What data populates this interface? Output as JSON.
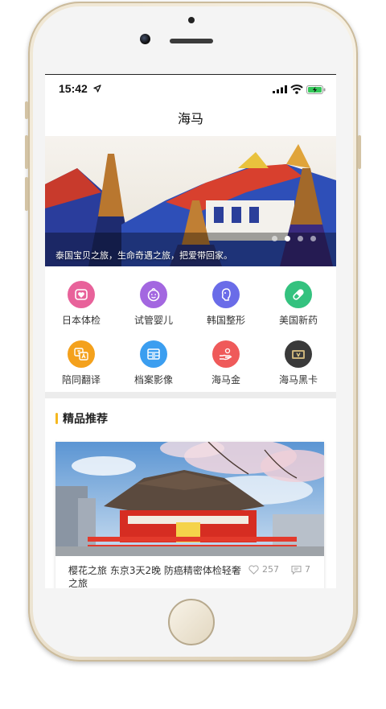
{
  "status_bar": {
    "time": "15:42"
  },
  "nav": {
    "title": "海马"
  },
  "banner": {
    "caption": "泰国宝贝之旅，生命奇遇之旅，把爱带回家。",
    "slide_count": 4,
    "active_slide": 2
  },
  "services": [
    {
      "label": "日本体检",
      "icon": "heart-check-icon",
      "color": "#e8629a"
    },
    {
      "label": "试管婴儿",
      "icon": "baby-face-icon",
      "color": "#a367e0"
    },
    {
      "label": "韩国整形",
      "icon": "face-profile-icon",
      "color": "#6a6ce8"
    },
    {
      "label": "美国新药",
      "icon": "pill-icon",
      "color": "#34c27f"
    },
    {
      "label": "陪同翻译",
      "icon": "translate-icon",
      "color": "#f4a11c"
    },
    {
      "label": "档案影像",
      "icon": "archive-box-icon",
      "color": "#3b9ef0"
    },
    {
      "label": "海马金",
      "icon": "coin-hand-icon",
      "color": "#ef5a5a"
    },
    {
      "label": "海马黑卡",
      "icon": "black-card-icon",
      "color": "#3a3a3a"
    }
  ],
  "featured": {
    "section_title": "精品推荐",
    "card": {
      "title": "樱花之旅 东京3天2晚 防癌精密体检轻奢之旅",
      "likes": "257",
      "comments": "7"
    }
  }
}
